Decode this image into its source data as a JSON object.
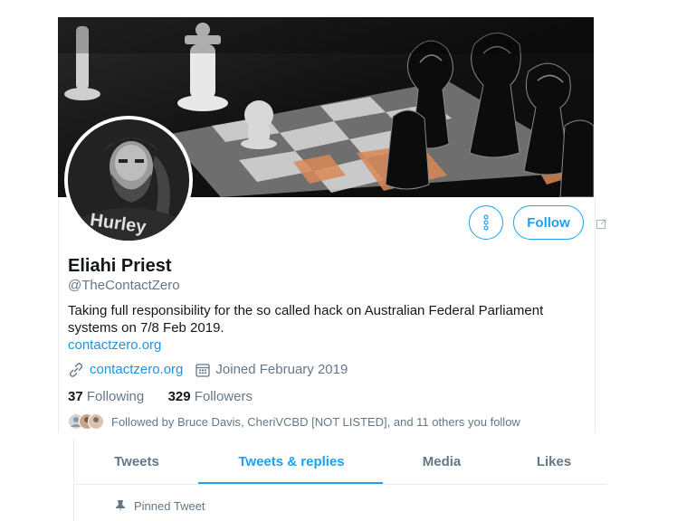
{
  "profile": {
    "name": "Eliahi Priest",
    "handle": "@TheContactZero",
    "bio": "Taking full responsibility for the so called hack on Australian Federal Parliament systems on 7/8 Feb 2019.",
    "bio_link": "contactzero.org",
    "website": "contactzero.org",
    "joined": "Joined February 2019",
    "following_count": "37",
    "following_label": "Following",
    "followers_count": "329",
    "followers_label": "Followers",
    "followed_by": "Followed by Bruce Davis, CheriVCBD [NOT LISTED], and 11 others you follow"
  },
  "actions": {
    "follow_label": "Follow",
    "more_icon": "more-vertical-icon",
    "external_icon": "external-link-icon"
  },
  "tabs": [
    {
      "label": "Tweets",
      "active": false
    },
    {
      "label": "Tweets & replies",
      "active": true
    },
    {
      "label": "Media",
      "active": false
    },
    {
      "label": "Likes",
      "active": false
    }
  ],
  "pinned": {
    "label": "Pinned Tweet",
    "icon": "pin-icon"
  },
  "colors": {
    "accent": "#1da1f2",
    "link": "#1b95e0",
    "muted": "#657786",
    "text": "#14171a"
  }
}
